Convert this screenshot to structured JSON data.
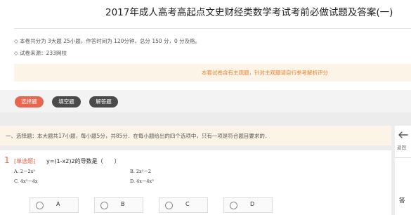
{
  "page": {
    "title": "2017年成人高考高起点文史财经类数学考试考前必做试题及答案(一)"
  },
  "exam_info": {
    "summary": "◇ 本卷共分为 3大题 25小题，作答时间为 120分钟，总分 150 分，0 分及格。",
    "source": "◇ 试卷来源：233网校",
    "notice": "本套试卷含有主观题，针对主观题请自行参考解析评分"
  },
  "tabs": [
    {
      "label": "选择题",
      "active": true
    },
    {
      "label": "填空题",
      "active": false
    },
    {
      "label": "解答题",
      "active": false
    }
  ],
  "section": {
    "text": "一、选择题：本大题共17小题，每小题5分，共85分．在每小题给出的四个选项中，只有一项是符合题目要求的．"
  },
  "question": {
    "number": "1",
    "type": "[单选题]",
    "text": "y=(1-x2)2的导数是（　　）",
    "options": [
      "A. 2－2x³",
      "B. 2x²－2",
      "C. 4x³－4x",
      "D. 4x－4x³"
    ]
  },
  "answer_choices": [
    "A",
    "B",
    "C",
    "D"
  ],
  "side_panel": {
    "back_label": "返回",
    "answer_label": "答"
  },
  "colors": {
    "accent": "#e8664d",
    "notice_text": "#ef7d2b",
    "dark_button": "#4a4a4a",
    "notice_bg": "#fdf4e8"
  }
}
